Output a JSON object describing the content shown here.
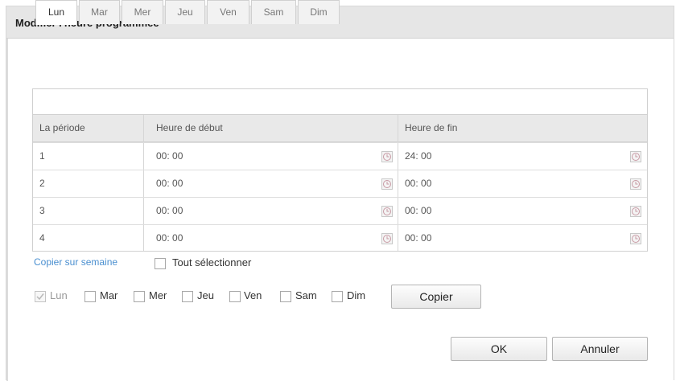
{
  "dialog": {
    "title": "Modifier l'heure programmée"
  },
  "tabs": [
    {
      "label": "Lun",
      "active": true
    },
    {
      "label": "Mar",
      "active": false
    },
    {
      "label": "Mer",
      "active": false
    },
    {
      "label": "Jeu",
      "active": false
    },
    {
      "label": "Ven",
      "active": false
    },
    {
      "label": "Sam",
      "active": false
    },
    {
      "label": "Dim",
      "active": false
    }
  ],
  "table": {
    "headers": {
      "period": "La période",
      "start": "Heure de début",
      "end": "Heure de fin"
    },
    "rows": [
      {
        "period": "1",
        "start": "00: 00",
        "end": "24: 00"
      },
      {
        "period": "2",
        "start": "00: 00",
        "end": "00: 00"
      },
      {
        "period": "3",
        "start": "00: 00",
        "end": "00: 00"
      },
      {
        "period": "4",
        "start": "00: 00",
        "end": "00: 00"
      }
    ]
  },
  "copy": {
    "link_label": "Copier sur semaine",
    "select_all_label": "Tout sélectionner",
    "days": [
      {
        "label": "Lun",
        "checked": true,
        "disabled": true
      },
      {
        "label": "Mar",
        "checked": false,
        "disabled": false
      },
      {
        "label": "Mer",
        "checked": false,
        "disabled": false
      },
      {
        "label": "Jeu",
        "checked": false,
        "disabled": false
      },
      {
        "label": "Ven",
        "checked": false,
        "disabled": false
      },
      {
        "label": "Sam",
        "checked": false,
        "disabled": false
      },
      {
        "label": "Dim",
        "checked": false,
        "disabled": false
      }
    ],
    "copy_button": "Copier"
  },
  "footer": {
    "ok_label": "OK",
    "cancel_label": "Annuler"
  },
  "colors": {
    "link": "#4a8fd0",
    "title_bar": "#e6e6e6",
    "table_header": "#e9e9e9"
  }
}
